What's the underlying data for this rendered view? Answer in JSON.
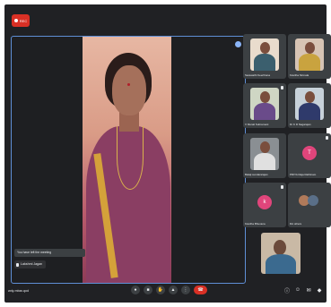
{
  "recording": {
    "label": "REC",
    "color": "#d93025"
  },
  "main_speaker": {
    "name": "Lakshmi Jagan",
    "tooltip": "You have left the meeting",
    "accent_border": "#5f8fd6"
  },
  "participants": [
    {
      "name": "Sarawathi Keerthana",
      "type": "video"
    },
    {
      "name": "Kavitha Nirmala",
      "type": "video"
    },
    {
      "name": "V Murali Subramani",
      "type": "video"
    },
    {
      "name": "Dr K R Nagarajan",
      "type": "video"
    },
    {
      "name": "Balaji sundararajan",
      "type": "video"
    },
    {
      "name": "PRIYA Raja Rathinam",
      "type": "avatar",
      "initial": "T",
      "color": "#e0457b"
    },
    {
      "name": "Kavitha Bhuvana",
      "type": "avatar",
      "initial": "k",
      "color": "#e0457b"
    },
    {
      "name": "DA others",
      "type": "avatar-multi"
    }
  ],
  "bottom_bar": {
    "meeting_code": "wdy-mbar-qod",
    "controls": [
      "mic-icon",
      "camera-icon",
      "hand-icon",
      "present-icon",
      "more-icon",
      "end-call-icon"
    ]
  },
  "colors": {
    "background": "#202124",
    "tile": "#3c4043",
    "end_call": "#d93025"
  }
}
